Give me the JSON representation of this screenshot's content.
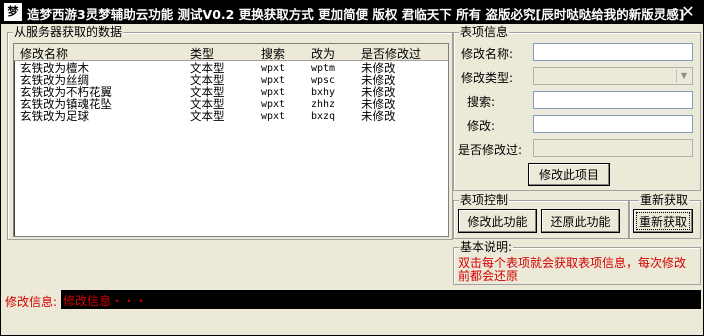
{
  "window": {
    "title": "造梦西游3灵梦辅助云功能 测试V0.2 更换获取方式 更加简便 版权 君临天下 所有 盗版必究[辰时哒哒给我的新版灵感]",
    "icon_glyph": "梦",
    "close_glyph": "✕"
  },
  "server_group": {
    "label": "从服务器获取的数据",
    "columns": [
      "修改名称",
      "类型",
      "搜索",
      "改为",
      "是否修改过"
    ],
    "rows": [
      [
        "玄铁改为檀木",
        "文本型",
        "wpxt",
        "wptm",
        "未修改"
      ],
      [
        "玄铁改为丝绸",
        "文本型",
        "wpxt",
        "wpsc",
        "未修改"
      ],
      [
        "玄铁改为不朽花翼",
        "文本型",
        "wpxt",
        "bxhy",
        "未修改"
      ],
      [
        "玄铁改为镇魂花坠",
        "文本型",
        "wpxt",
        "zhhz",
        "未修改"
      ],
      [
        "玄铁改为足球",
        "文本型",
        "wpxt",
        "bxzq",
        "未修改"
      ]
    ]
  },
  "item_info": {
    "label": "表项信息",
    "name_label": "修改名称:",
    "type_label": "修改类型:",
    "search_label": "搜索:",
    "modify_label": "修改:",
    "modified_label": "是否修改过:",
    "name_value": "",
    "type_value": "",
    "search_value": "",
    "modify_value": "",
    "modified_value": "",
    "modify_item_button": "修改此项目"
  },
  "control": {
    "label": "表项控制",
    "modify_function_button": "修改此功能",
    "restore_function_button": "还原此功能"
  },
  "refetch": {
    "label": "重新获取",
    "button": "重新获取"
  },
  "basic": {
    "label": "基本说明:",
    "note": "双击每个表项就会获取表项信息，每次修改前都会还原"
  },
  "status": {
    "label": "修改信息:",
    "value": "修改信息・・・"
  },
  "colors": {
    "background": "#ece9d8",
    "title_bar": "#000000",
    "accent_red": "#d40000",
    "status_box": "#000000"
  }
}
